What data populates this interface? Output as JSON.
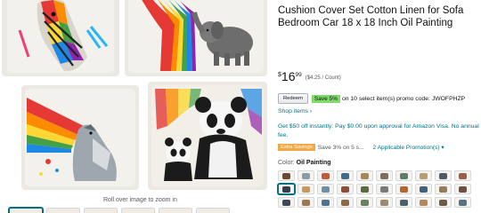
{
  "gallery": {
    "images": [
      {
        "name": "rainbow-zebra-pillow"
      },
      {
        "name": "elephant-rainbow-pillow"
      },
      {
        "name": "howling-wolf-pillow"
      },
      {
        "name": "panda-family-pillow"
      }
    ],
    "zoom_hint": "Roll over image to zoom in",
    "thumbnail_count": 6
  },
  "product": {
    "title": "Theme Outdoor Pillow Cover Ocean Animal Cushion Cover Set Cotton Linen for Sofa Bedroom Car 18 x 18 Inch Oil Painting",
    "price": {
      "symbol": "$",
      "whole": "16",
      "fraction": "99",
      "per_count": "($4.25 / Count)"
    },
    "coupon": {
      "redeem_label": "Redeem",
      "save_badge": "Save 5%",
      "text": "on 10 select item(s) promo code: JWOFPHZP"
    },
    "shop_items_label": "Shop items ›",
    "visa_offer": "Get $50 off instantly: Pay $0.00 upon approval for Amazon Visa. No annual fee.",
    "promotion": {
      "badge": "Extra Savings",
      "description": "Save 3% on 5 s...",
      "link": "2 Applicable Promotion(s) ▾"
    },
    "color": {
      "label": "Color:",
      "value": "Oil Painting"
    },
    "swatch_colors": [
      "#6b4a2f",
      "#8a9aa6",
      "#c25b3a",
      "#3f6b8f",
      "#a48a55",
      "#7d6e5e",
      "#5d7f6a",
      "#b79c74",
      "#4e5a66",
      "#9a5f4a",
      "#2f3f4f",
      "#c49a62",
      "#6f8fa8",
      "#8e4e3a",
      "#5a6b3f",
      "#7a7a7a",
      "#b5652f",
      "#41617a",
      "#947b5a",
      "#6a5040",
      "#3a4a5a",
      "#a07850",
      "#527090",
      "#8b6a4a",
      "#6b8060",
      "#9a8a70",
      "#4a5f70",
      "#b08a5a",
      "#705a48",
      "#5a7085"
    ],
    "selected_swatch_index": 10
  },
  "colors": {
    "link": "#007185",
    "save_badge": "#7fda69",
    "extra_savings_badge": "#f3a847"
  }
}
